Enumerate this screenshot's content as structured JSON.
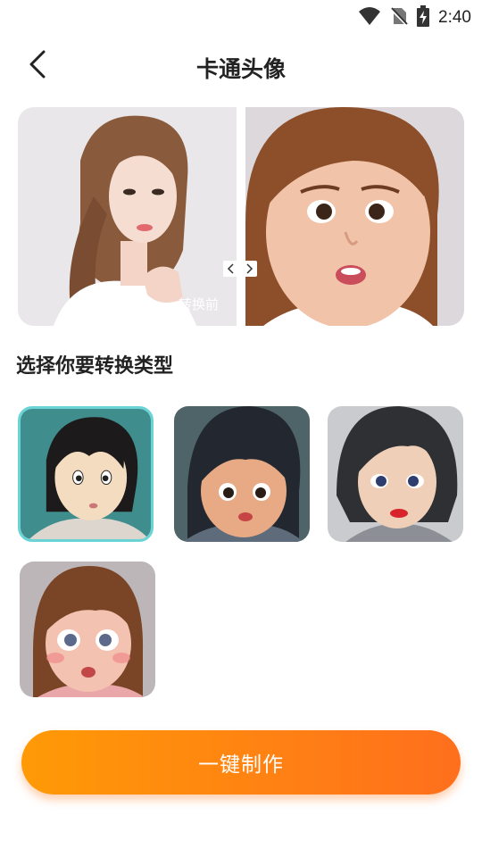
{
  "status_bar": {
    "time": "2:40",
    "icons": [
      "wifi-icon",
      "no-sim-icon",
      "battery-charging-icon"
    ]
  },
  "header": {
    "back_icon": "chevron-left-icon",
    "title": "卡通头像"
  },
  "compare": {
    "before_label": "转换前",
    "prev_icon": "chevron-left-icon",
    "next_icon": "chevron-right-icon"
  },
  "section": {
    "title": "选择你要转换类型"
  },
  "styles": [
    {
      "name": "anime-style-1",
      "selected": true
    },
    {
      "name": "cartoon-style-2",
      "selected": false
    },
    {
      "name": "cartoon-style-3",
      "selected": false
    },
    {
      "name": "cartoon-style-4",
      "selected": false
    }
  ],
  "action": {
    "label": "一键制作"
  },
  "colors": {
    "button_start": "#ff9a06",
    "button_end": "#ff6f1d",
    "selected_border": "#6ad3d6"
  }
}
